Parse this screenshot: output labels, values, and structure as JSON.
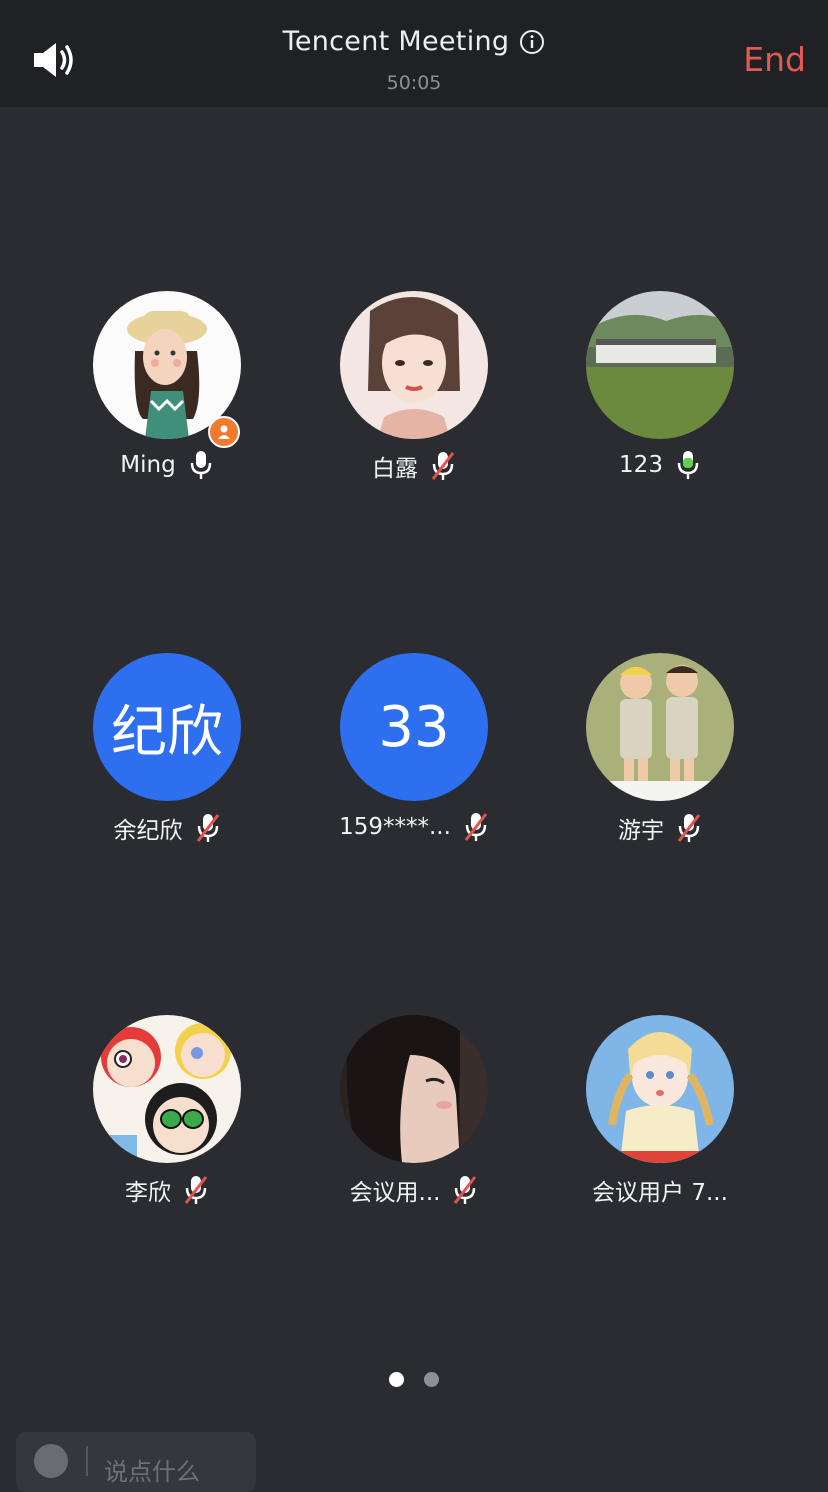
{
  "header": {
    "title": "Tencent Meeting",
    "timer": "50:05",
    "end_label": "End"
  },
  "icons": {
    "speaker": "speaker-icon",
    "info": "info-icon",
    "mic_on": "microphone-icon",
    "mic_muted": "microphone-muted-icon",
    "host": "host-badge-icon"
  },
  "participants": [
    {
      "name": "Ming",
      "mic": "on",
      "host": true
    },
    {
      "name": "白露",
      "mic": "muted"
    },
    {
      "name": "123",
      "mic": "speaking"
    },
    {
      "name": "余纪欣",
      "mic": "muted",
      "avatar_text": "纪欣"
    },
    {
      "name": "159****...",
      "mic": "muted",
      "avatar_text": "33"
    },
    {
      "name": "游宇",
      "mic": "muted"
    },
    {
      "name": "李欣",
      "mic": "muted"
    },
    {
      "name": "会议用...",
      "mic": "muted"
    },
    {
      "name": "会议用户 7...",
      "mic": "none"
    }
  ],
  "pagination": {
    "pages": 2,
    "current": 1
  },
  "chat": {
    "placeholder": "说点什么"
  },
  "colors": {
    "end": "#e25a54",
    "text_avatar": "#2d6fee",
    "speaking": "#5fd14a",
    "muted_slash": "#e5524c",
    "host_badge": "#f07b2e"
  }
}
